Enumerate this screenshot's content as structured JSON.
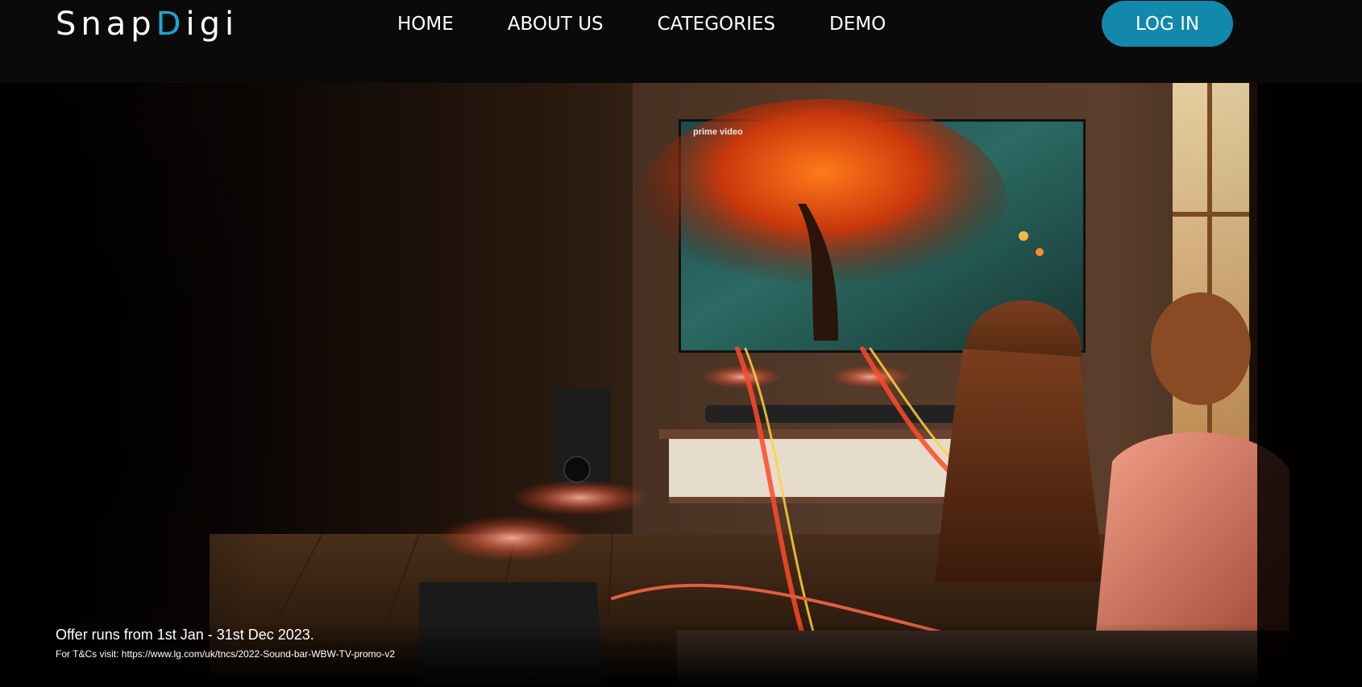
{
  "brand": {
    "logo_part1": "Snap",
    "logo_accent": "D",
    "logo_part2": "igi",
    "accent_color": "#1aa6d6"
  },
  "nav": {
    "links": [
      "HOME",
      "ABOUT US",
      "CATEGORIES",
      "DEMO"
    ],
    "login_label": "LOG IN",
    "login_color": "#1288ab"
  },
  "hero": {
    "tv_brand": "prime video",
    "offer": "Offer runs from 1st Jan - 31st Dec 2023.",
    "terms": "For T&Cs visit: https://www.lg.com/uk/tncs/2022-Sound-bar-WBW-TV-promo-v2"
  }
}
